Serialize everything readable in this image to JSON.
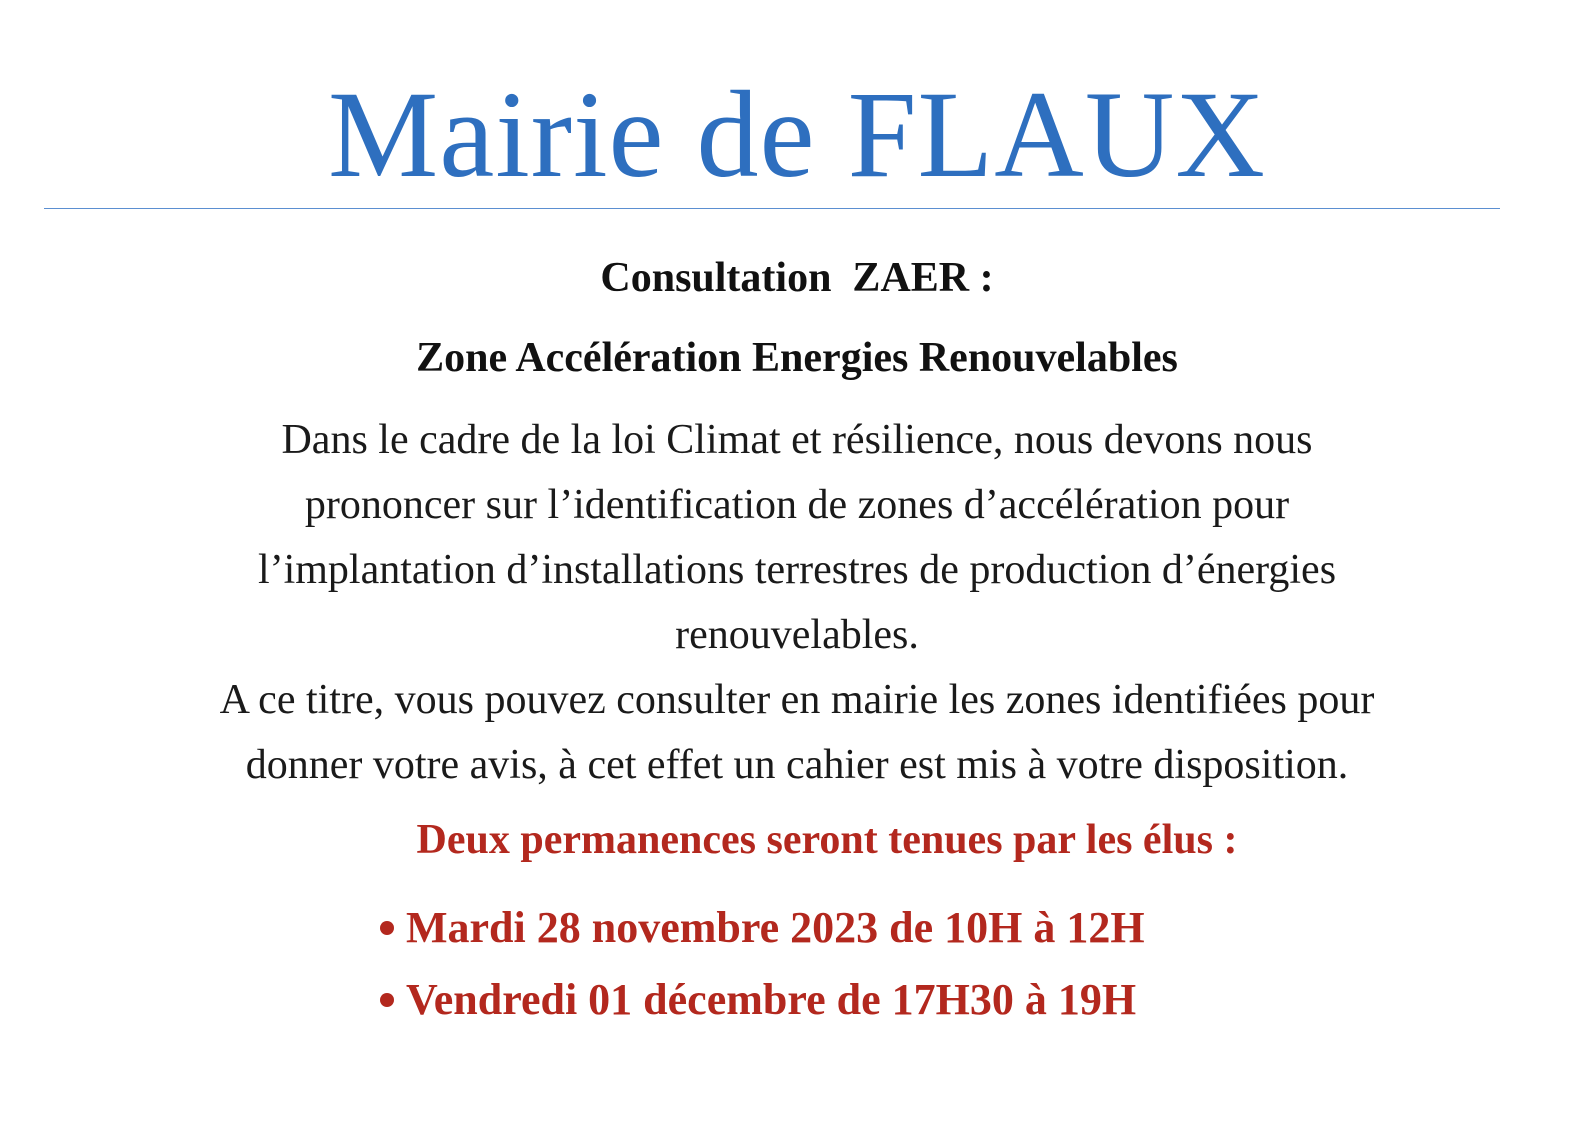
{
  "document": {
    "title": "Mairie de FLAUX",
    "heading_1": "Consultation  ZAER :",
    "heading_2": "Zone Accélération Energies Renouvelables",
    "paragraph_1": [
      "Dans le cadre de la loi Climat et résilience, nous devons nous",
      "prononcer sur l’identification de zones d’accélération pour",
      "l’implantation d’installations terrestres de production d’énergies",
      "renouvelables."
    ],
    "paragraph_2": [
      "A ce titre, vous pouvez consulter en mairie les zones identifiées pour",
      "donner votre avis, à cet effet un cahier est mis à votre disposition."
    ],
    "permanences_heading": "Deux permanences seront tenues par les élus :",
    "permanences": [
      "Mardi 28 novembre 2023 de 10H à 12H",
      "Vendredi 01 décembre de 17H30 à 19H"
    ]
  },
  "colors": {
    "title": "#2e6fbf",
    "rule": "#5b8fd1",
    "body_text": "#1a1a1a",
    "accent_red": "#b3281e"
  }
}
